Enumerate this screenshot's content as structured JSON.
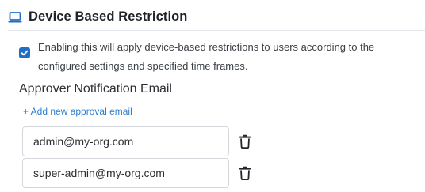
{
  "section": {
    "title": "Device Based Restriction",
    "icon": "laptop-icon"
  },
  "restriction_checkbox": {
    "checked": true,
    "label": "Enabling this will apply device-based restrictions to users according to the configured settings and specified time frames."
  },
  "approver": {
    "title": "Approver Notification Email",
    "add_link": "+ Add new approval email",
    "emails": [
      {
        "value": "admin@my-org.com",
        "delete_icon": "trash-icon"
      },
      {
        "value": "super-admin@my-org.com",
        "delete_icon": "trash-icon"
      }
    ]
  },
  "colors": {
    "accent": "#1f6fc5",
    "link": "#2d7fd0",
    "border": "#d4d8dd"
  }
}
